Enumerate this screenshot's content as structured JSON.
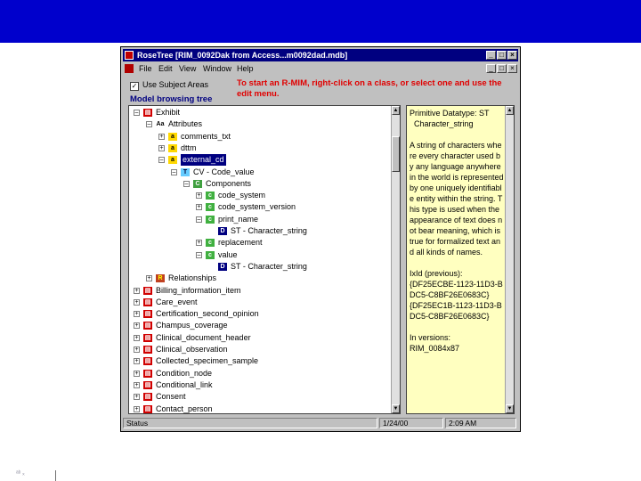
{
  "window": {
    "title": "RoseTree [RIM_0092Dak from Access...m0092dad.mdb]",
    "controls": {
      "minimize": "_",
      "maximize": "□",
      "close": "×"
    }
  },
  "menu": {
    "items": [
      "File",
      "Edit",
      "View",
      "Window",
      "Help"
    ]
  },
  "hint": "To start an R-MIM, right-click on a class, or select one and use the edit menu.",
  "subject_areas": {
    "label": "Use Subject Areas",
    "checked": true
  },
  "panel_title": "Model browsing tree",
  "tree": [
    {
      "label": "Exhibit",
      "expander": "-",
      "icon": "class"
    },
    {
      "label": "Attributes",
      "expander": "-",
      "icon": "attr-group"
    },
    {
      "label": "comments_txt",
      "expander": "+",
      "icon": "attr"
    },
    {
      "label": "dttm",
      "expander": "+",
      "icon": "attr"
    },
    {
      "label": "external_cd",
      "expander": "-",
      "icon": "attr",
      "selected": true
    },
    {
      "label": "CV - Code_value",
      "expander": "-",
      "icon": "type"
    },
    {
      "label": "Components",
      "expander": "-",
      "icon": "components"
    },
    {
      "label": "code_system",
      "expander": "+",
      "icon": "component"
    },
    {
      "label": "code_system_version",
      "expander": "+",
      "icon": "component"
    },
    {
      "label": "print_name",
      "expander": "-",
      "icon": "component"
    },
    {
      "label": "ST - Character_string",
      "expander": "",
      "icon": "datatype"
    },
    {
      "label": "replacement",
      "expander": "+",
      "icon": "component"
    },
    {
      "label": "value",
      "expander": "-",
      "icon": "component"
    },
    {
      "label": "ST - Character_string",
      "expander": "",
      "icon": "datatype"
    },
    {
      "label": "Relationships",
      "expander": "+",
      "icon": "relationships"
    },
    {
      "label": "Billing_information_item",
      "expander": "+",
      "icon": "class"
    },
    {
      "label": "Care_event",
      "expander": "+",
      "icon": "class"
    },
    {
      "label": "Certification_second_opinion",
      "expander": "+",
      "icon": "class"
    },
    {
      "label": "Champus_coverage",
      "expander": "+",
      "icon": "class"
    },
    {
      "label": "Clinical_document_header",
      "expander": "+",
      "icon": "class"
    },
    {
      "label": "Clinical_observation",
      "expander": "+",
      "icon": "class"
    },
    {
      "label": "Collected_specimen_sample",
      "expander": "+",
      "icon": "class"
    },
    {
      "label": "Condition_node",
      "expander": "+",
      "icon": "class"
    },
    {
      "label": "Conditional_link",
      "expander": "+",
      "icon": "class"
    },
    {
      "label": "Consent",
      "expander": "+",
      "icon": "class"
    },
    {
      "label": "Contact_person",
      "expander": "+",
      "icon": "class"
    }
  ],
  "description": "Primitive Datatype: ST\n  Character_string\n\nA string of characters where every character used by any language anywhere in the world is represented by one uniquely identifiable entity within the string. This type is used when the appearance of text does not bear meaning, which is true for formalized text and all kinds of names.\n\nIxId (previous):\n{DF25ECBE-1123-11D3-BDC5-C8BF26E0683C}\n{DF25EC1B-1123-11D3-BDC5-C8BF26E0683C}\n\nIn versions:\nRIM_0084x87",
  "status": {
    "text": "Status",
    "date": "1/24/00",
    "time": "2:09 AM"
  },
  "footer": "ᵃᵇ ₓ"
}
